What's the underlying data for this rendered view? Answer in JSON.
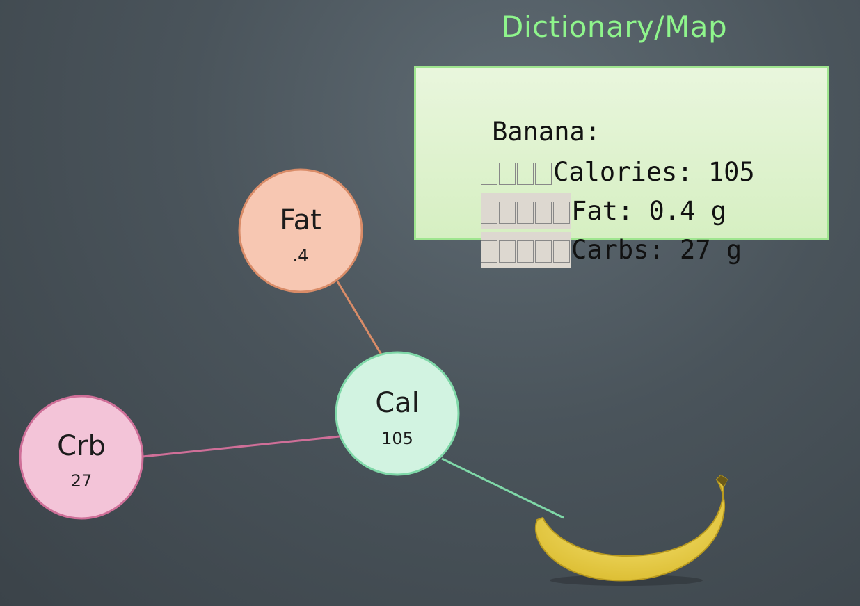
{
  "title": "Dictionary/Map",
  "code": {
    "line1": "Banana:",
    "line2": "Calories: 105",
    "line3": "Fat: 0.4 g",
    "line4": "Carbs: 27 g"
  },
  "nodes": {
    "fat": {
      "label": "Fat",
      "value": ".4"
    },
    "cal": {
      "label": "Cal",
      "value": "105"
    },
    "crb": {
      "label": "Crb",
      "value": "27"
    }
  },
  "colors": {
    "title": "#8ff58c",
    "fat_fill": "#f7c7b2",
    "fat_stroke": "#d98c68",
    "cal_fill": "#d2f3e1",
    "cal_stroke": "#7fd8a8",
    "crb_fill": "#f3c4d8",
    "crb_stroke": "#cf6f98",
    "banana": "#f2d94a"
  },
  "icons": [
    "banana-image"
  ]
}
